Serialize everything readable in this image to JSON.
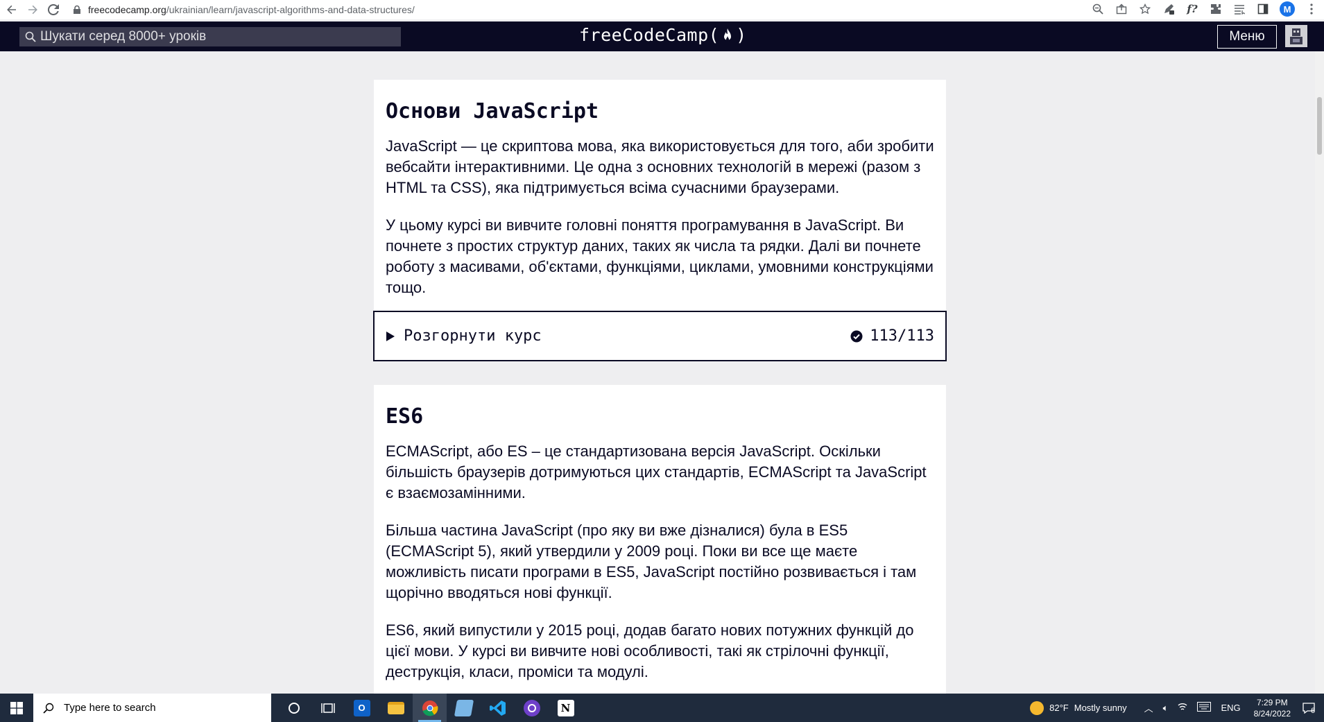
{
  "browser": {
    "url_host": "freecodecamp.org",
    "url_path": "/ukrainian/learn/javascript-algorithms-and-data-structures/",
    "profile_initial": "M"
  },
  "navbar": {
    "search_placeholder": "Шукати серед 8000+ уроків",
    "logo_text_left": "freeCodeCamp(",
    "logo_text_right": ")",
    "menu_label": "Меню"
  },
  "sections": [
    {
      "title": "Основи JavaScript",
      "paragraphs": [
        "JavaScript — це скриптова мова, яка використовується для того, аби зробити вебсайти інтерактивними. Це одна з основних технологій в мережі (разом з HTML та CSS), яка підтримується всіма сучасними браузерами.",
        "У цьому курсі ви вивчите головні поняття програмування в JavaScript. Ви почнете з простих структур даних, таких як числа та рядки. Далі ви почнете роботу з масивами, об'єктами, функціями, циклами, умовними конструкціями тощо."
      ],
      "expand_label": "Розгорнути курс",
      "progress": "113/113"
    },
    {
      "title": "ES6",
      "paragraphs": [
        "ECMAScript, або ES – це стандартизована версія JavaScript. Оскільки більшість браузерів дотримуються цих стандартів, ECMAScript та JavaScript є взаємозамінними.",
        "Більша частина JavaScript (про яку ви вже дізналися) була в ES5 (ECMAScript 5), який утвердили у 2009 році. Поки ви все ще маєте можливість писати програми в ES5, JavaScript постійно розвивається і там щорічно вводяться нові функції.",
        "ES6, який випустили у 2015 році, додав багато нових потужних функцій до цієї мови. У курсі ви вивчите нові особливості, такі як стрілочні функції, деструкція, класи, проміси та модулі."
      ]
    }
  ],
  "taskbar": {
    "search_placeholder": "Type here to search",
    "weather_temp": "82°F",
    "weather_desc": "Mostly sunny",
    "language": "ENG",
    "time": "7:29 PM",
    "date": "8/24/2022",
    "notification_count": "6"
  }
}
